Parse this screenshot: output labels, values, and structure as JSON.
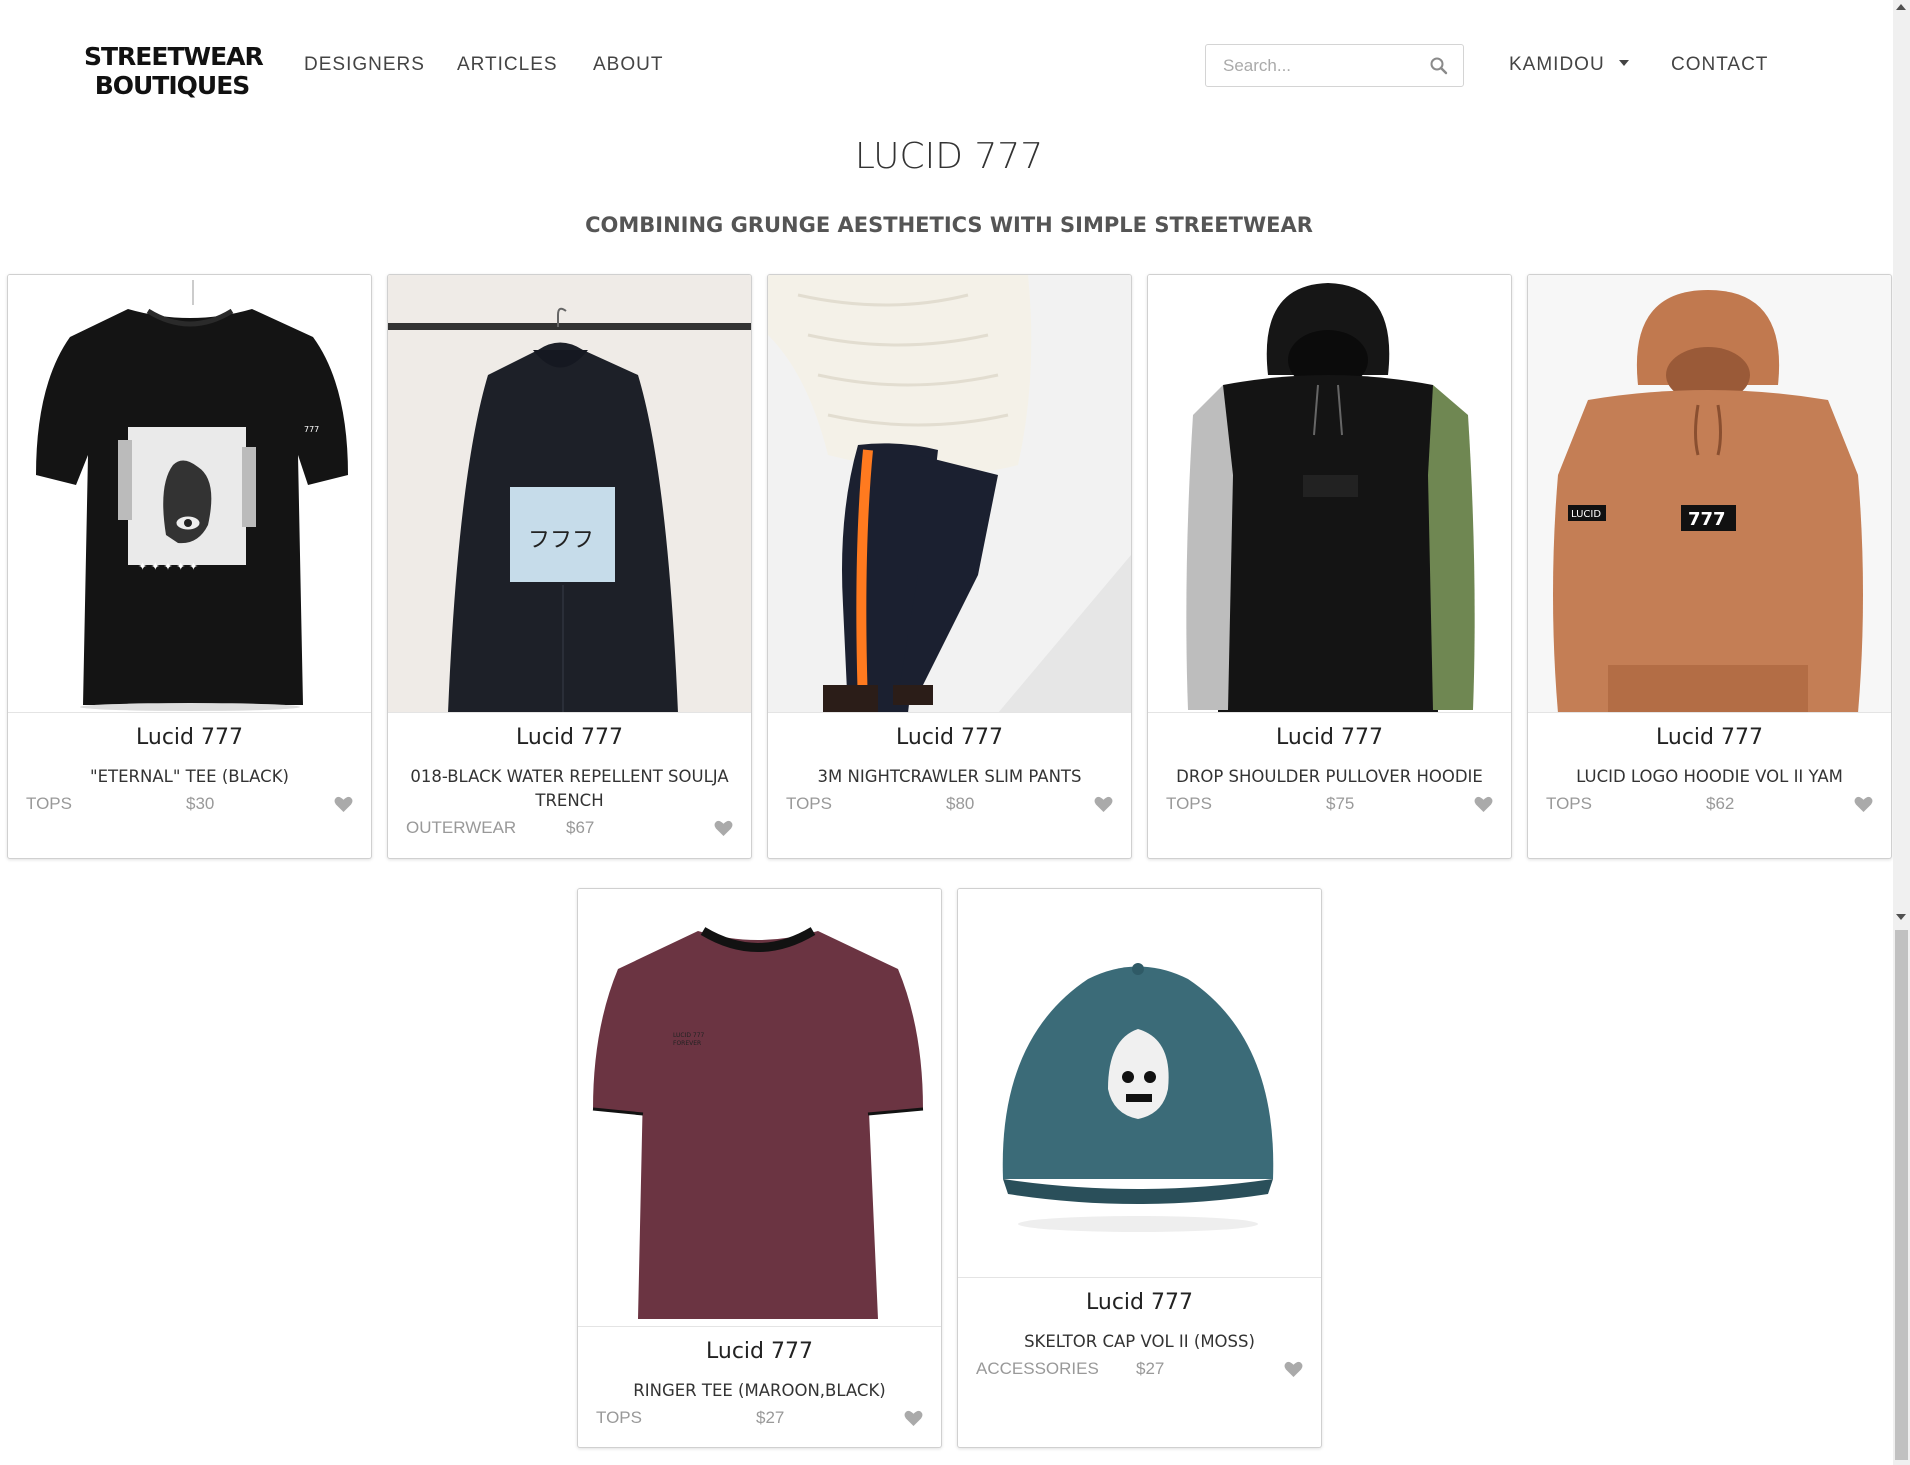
{
  "nav": {
    "logo_line1": "STREETWEAR",
    "logo_line2": "BOUTIQUES",
    "links": [
      "DESIGNERS",
      "ARTICLES",
      "ABOUT"
    ],
    "search_placeholder": "Search...",
    "search_value": "",
    "user_label": "KAMIDOU",
    "contact_label": "CONTACT"
  },
  "header": {
    "title": "LUCID 777",
    "subtitle": "COMBINING GRUNGE AESTHETICS WITH SIMPLE STREETWEAR"
  },
  "products": [
    {
      "brand": "Lucid 777",
      "name": "\"ETERNAL\" TEE (BLACK)",
      "category": "TOPS",
      "price": "$30",
      "image": "black-graphic-tee"
    },
    {
      "brand": "Lucid 777",
      "name": "018-BLACK WATER REPELLENT SOULJA TRENCH",
      "category": "OUTERWEAR",
      "price": "$67",
      "image": "black-trench-coat"
    },
    {
      "brand": "Lucid 777",
      "name": "3M NIGHTCRAWLER SLIM PANTS",
      "category": "TOPS",
      "price": "$80",
      "image": "track-pants-orange-stripe"
    },
    {
      "brand": "Lucid 777",
      "name": "DROP SHOULDER PULLOVER HOODIE",
      "category": "TOPS",
      "price": "$75",
      "image": "colorblock-hoodie"
    },
    {
      "brand": "Lucid 777",
      "name": "LUCID LOGO HOODIE VOL II YAM",
      "category": "TOPS",
      "price": "$62",
      "image": "orange-logo-hoodie"
    },
    {
      "brand": "Lucid 777",
      "name": "RINGER TEE (MAROON,BLACK)",
      "category": "TOPS",
      "price": "$27",
      "image": "maroon-ringer-tee"
    },
    {
      "brand": "Lucid 777",
      "name": "SKELTOR CAP VOL II (MOSS)",
      "category": "ACCESSORIES",
      "price": "$27",
      "image": "teal-skull-cap"
    }
  ],
  "colors": {
    "text": "#333333",
    "muted": "#999999",
    "border": "#d0d0d0",
    "heart": "#aaaaaa"
  }
}
